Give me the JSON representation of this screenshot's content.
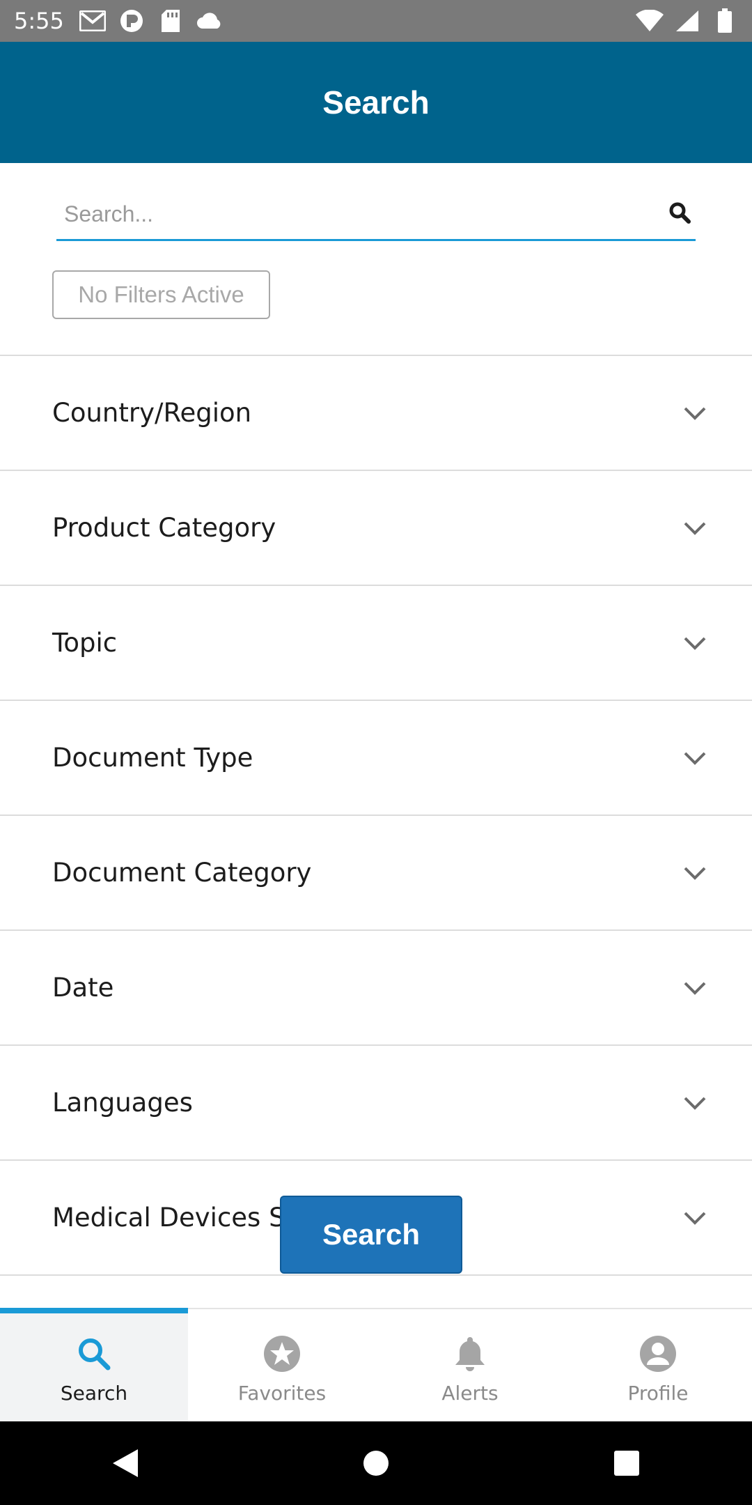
{
  "status_bar": {
    "time": "5:55",
    "left_icons": [
      "gmail-icon",
      "pocket-icon",
      "sd-card-icon",
      "cloud-icon"
    ],
    "right_icons": [
      "wifi-icon",
      "signal-icon",
      "battery-icon"
    ]
  },
  "app_bar": {
    "title": "Search"
  },
  "search": {
    "placeholder": "Search..."
  },
  "filters_pill": {
    "label": "No Filters Active"
  },
  "filters": [
    {
      "label": "Country/Region"
    },
    {
      "label": "Product Category"
    },
    {
      "label": "Topic"
    },
    {
      "label": "Document Type"
    },
    {
      "label": "Document Category"
    },
    {
      "label": "Date"
    },
    {
      "label": "Languages"
    },
    {
      "label": "Medical Devices Spe"
    }
  ],
  "search_button": {
    "label": "Search"
  },
  "bottom_nav": {
    "tabs": [
      {
        "label": "Search",
        "icon": "search-icon",
        "active": true
      },
      {
        "label": "Favorites",
        "icon": "star-icon",
        "active": false
      },
      {
        "label": "Alerts",
        "icon": "bell-icon",
        "active": false
      },
      {
        "label": "Profile",
        "icon": "profile-icon",
        "active": false
      }
    ]
  },
  "colors": {
    "header": "#00638c",
    "accent": "#1a9ad6",
    "button": "#1e73b8"
  }
}
